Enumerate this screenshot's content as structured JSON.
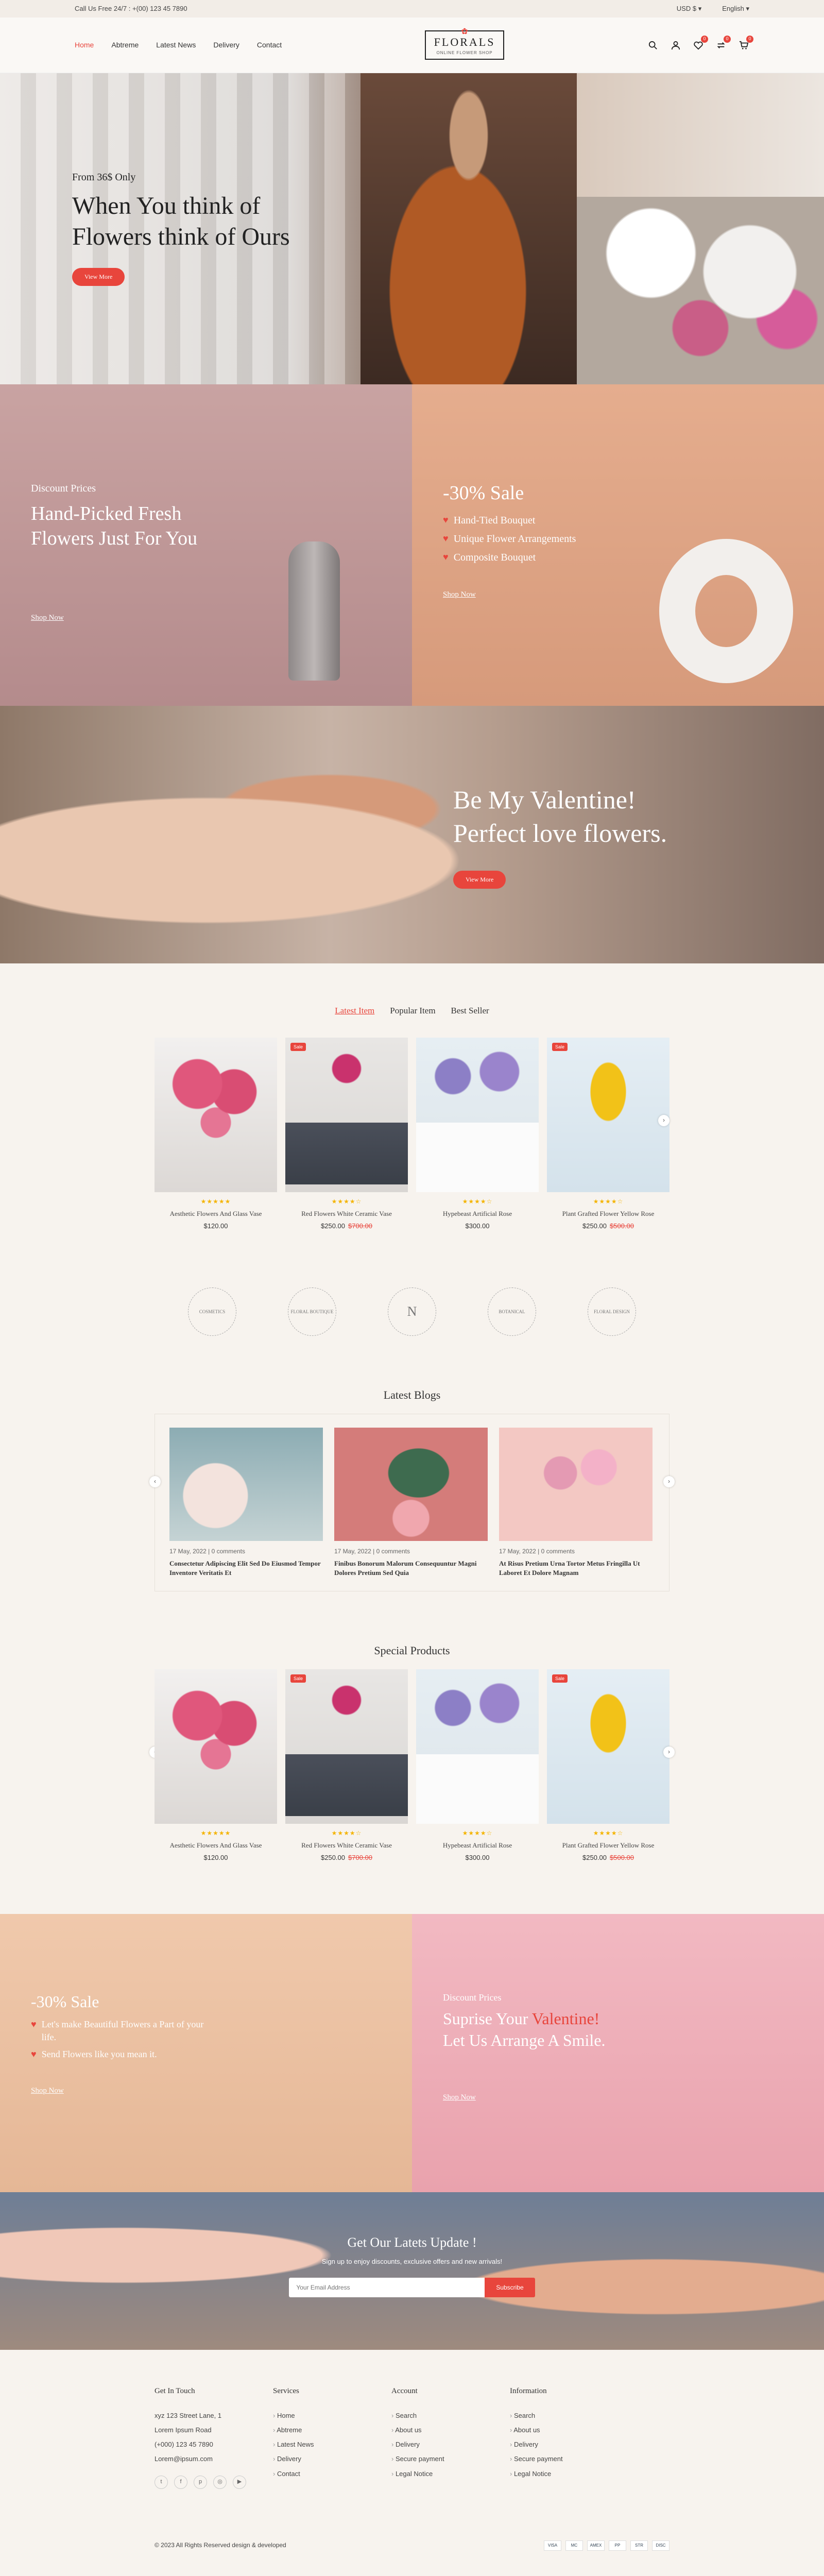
{
  "topbar": {
    "call": "Call Us Free 24/7 : +(00) 123 45 7890",
    "currency": "USD $",
    "language": "English"
  },
  "nav": [
    "Home",
    "Abtreme",
    "Latest News",
    "Delivery",
    "Contact"
  ],
  "logo": {
    "title": "FLORALS",
    "subtitle": "ONLINE FLOWER SHOP"
  },
  "header_badges": {
    "wishlist": "0",
    "compare": "0",
    "cart": "0"
  },
  "hero": {
    "from": "From 36$ Only",
    "title_line1": "When You think of",
    "title_line2": "Flowers think of Ours",
    "button": "View More"
  },
  "banner_left": {
    "small": "Discount Prices",
    "title_line1": "Hand-Picked Fresh",
    "title_line2": "Flowers Just For You",
    "link": "Shop Now"
  },
  "banner_right": {
    "title": "-30% Sale",
    "items": [
      "Hand-Tied Bouquet",
      "Unique Flower Arrangements",
      "Composite Bouquet"
    ],
    "link": "Shop Now"
  },
  "valentine": {
    "line1": "Be My Valentine!",
    "line2": "Perfect love flowers.",
    "button": "View More"
  },
  "tabs": [
    "Latest Item",
    "Popular Item",
    "Best Seller"
  ],
  "products": [
    {
      "name": "Aesthetic Flowers And Glass Vase",
      "price": "$120.00",
      "old": "",
      "sale": "",
      "rating": "★★★★★"
    },
    {
      "name": "Red Flowers White Ceramic Vase",
      "price": "$250.00",
      "old": "$700.00",
      "sale": "Sale",
      "rating": "★★★★☆"
    },
    {
      "name": "Hypebeast Artificial Rose",
      "price": "$300.00",
      "old": "",
      "sale": "",
      "rating": "★★★★☆"
    },
    {
      "name": "Plant Grafted Flower Yellow Rose",
      "price": "$250.00",
      "old": "$500.00",
      "sale": "Sale",
      "rating": "★★★★☆"
    }
  ],
  "brands": [
    "COSMETICS",
    "FLORAL BOUTIQUE",
    "N",
    "BOTANICAL",
    "FLORAL DESIGN"
  ],
  "blogs": {
    "title": "Latest Blogs",
    "items": [
      {
        "meta": "17 May, 2022 | 0 comments",
        "title": "Consectetur Adipiscing Elit Sed Do Eiusmod Tempor Inventore Veritatis Et"
      },
      {
        "meta": "17 May, 2022 | 0 comments",
        "title": "Finibus Bonorum Malorum Consequuntur Magni Dolores Pretium Sed Quia"
      },
      {
        "meta": "17 May, 2022 | 0 comments",
        "title": "At Risus Pretium Urna Tortor Metus Fringilla Ut Laboret Et Dolore Magnam"
      }
    ]
  },
  "special": {
    "title": "Special Products"
  },
  "promo_left": {
    "title": "-30% Sale",
    "items": [
      "Let's make Beautiful Flowers a Part of your life.",
      "Send Flowers like you mean it."
    ],
    "link": "Shop Now"
  },
  "promo_right": {
    "small": "Discount Prices",
    "line1a": "Suprise Your ",
    "line1b": "Valentine!",
    "line2": "Let Us Arrange A Smile.",
    "link": "Shop Now"
  },
  "newsletter": {
    "title": "Get Our Latets Update !",
    "text": "Sign up to enjoy discounts, exclusive offers and new arrivals!",
    "placeholder": "Your Email Address",
    "button": "Subscribe"
  },
  "footer": {
    "touch": {
      "title": "Get In Touch",
      "address": "xyz 123 Street Lane, 1",
      "address2": "Lorem Ipsum Road",
      "phone": "(+000) 123 45 7890",
      "email": "Lorem@ipsum.com"
    },
    "services": {
      "title": "Services",
      "items": [
        "Home",
        "Abtreme",
        "Latest News",
        "Delivery",
        "Contact"
      ]
    },
    "account": {
      "title": "Account",
      "items": [
        "Search",
        "About us",
        "Delivery",
        "Secure payment",
        "Legal Notice"
      ]
    },
    "information": {
      "title": "Information",
      "items": [
        "Search",
        "About us",
        "Delivery",
        "Secure payment",
        "Legal Notice"
      ]
    }
  },
  "copyright": "© 2023 All Rights Reserved design & developed",
  "payments": [
    "VISA",
    "MC",
    "AMEX",
    "PP",
    "STR",
    "DISC"
  ],
  "colors": {
    "accent": "#e8453c",
    "background": "#f7f3ee"
  }
}
